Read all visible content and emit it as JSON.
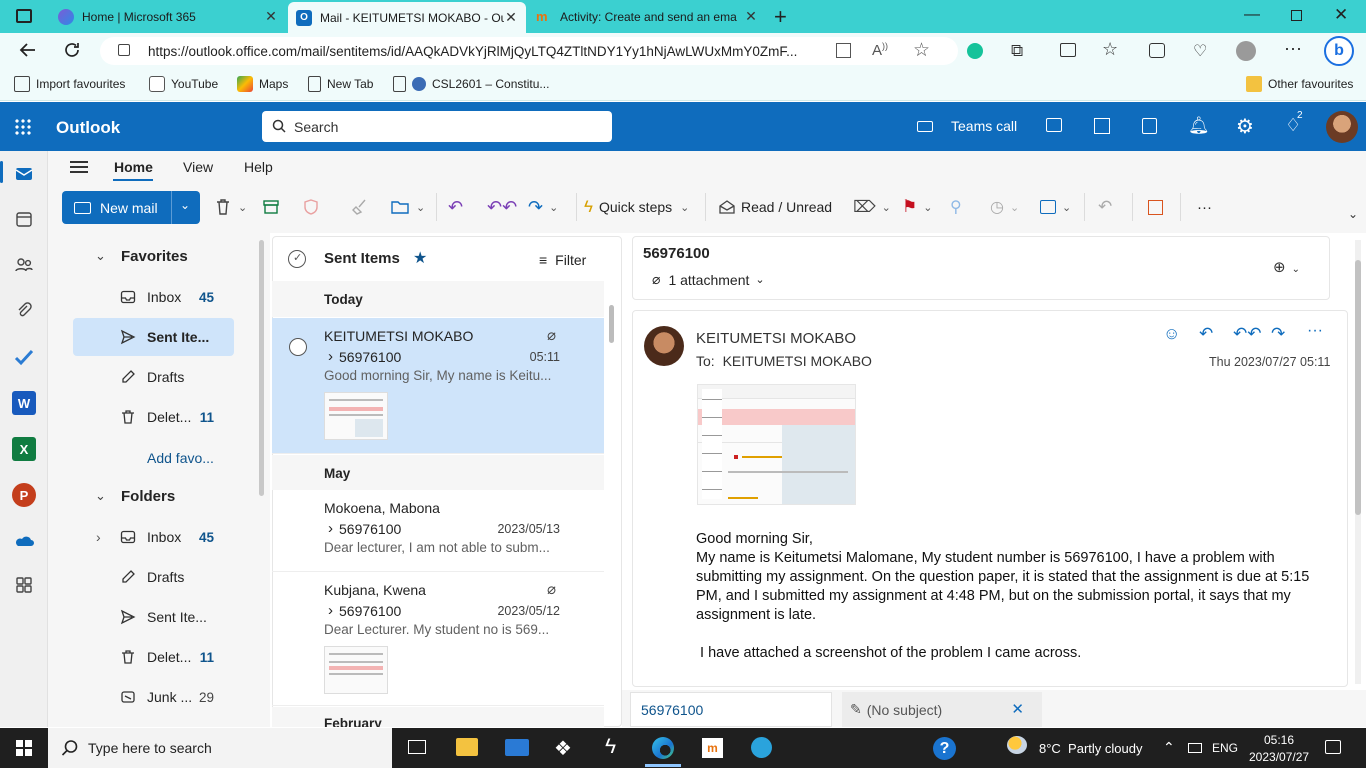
{
  "browser": {
    "tabs": [
      {
        "title": "Home | Microsoft 365",
        "active": false
      },
      {
        "title": "Mail - KEITUMETSI MOKABO - Out",
        "active": true
      },
      {
        "title": "Activity: Create and send an ema",
        "active": false
      }
    ],
    "url": "https://outlook.office.com/mail/sentitems/id/AAQkADVkYjRlMjQyLTQ4ZTltNDY1Yy1hNjAwLWUxMmY0ZmF...",
    "favorites": [
      "Import favourites",
      "YouTube",
      "Maps",
      "New Tab",
      "CSL2601 – Constitu...",
      "Other favourites"
    ]
  },
  "header": {
    "app_name": "Outlook",
    "search_placeholder": "Search",
    "teams_call": "Teams call",
    "notification_badge": "2"
  },
  "ribbon": {
    "tabs": [
      "Home",
      "View",
      "Help"
    ],
    "new_mail": "New mail",
    "quick_steps": "Quick steps",
    "read_unread": "Read / Unread",
    "more": "···"
  },
  "folders": {
    "favorites_heading": "Favorites",
    "favorites": [
      {
        "name": "Inbox",
        "count": "45"
      },
      {
        "name": "Sent Ite...",
        "count": ""
      },
      {
        "name": "Drafts",
        "count": ""
      },
      {
        "name": "Delet...",
        "count": "11"
      }
    ],
    "add_favorite": "Add favo...",
    "folders_heading": "Folders",
    "folders": [
      {
        "name": "Inbox",
        "count": "45"
      },
      {
        "name": "Drafts",
        "count": ""
      },
      {
        "name": "Sent Ite...",
        "count": ""
      },
      {
        "name": "Delet...",
        "count": "11"
      },
      {
        "name": "Junk ...",
        "count": "29"
      }
    ]
  },
  "message_list": {
    "title": "Sent Items",
    "filter": "Filter",
    "groups": [
      "Today",
      "May",
      "February"
    ],
    "messages": [
      {
        "sender": "KEITUMETSI MOKABO",
        "subject": "56976100",
        "date": "05:11",
        "preview": "Good morning Sir, My name is Keitu..."
      },
      {
        "sender": "Mokoena, Mabona",
        "subject": "56976100",
        "date": "2023/05/13",
        "preview": "Dear lecturer, I am not able to subm..."
      },
      {
        "sender": "Kubjana, Kwena",
        "subject": "56976100",
        "date": "2023/05/12",
        "preview": "Dear Lecturer. My student no is 569..."
      }
    ]
  },
  "reading_pane": {
    "subject": "56976100",
    "attachments": "1 attachment",
    "from": "KEITUMETSI MOKABO",
    "to_label": "To:",
    "to": "KEITUMETSI MOKABO",
    "date": "Thu 2023/07/27 05:11",
    "body": {
      "greeting": "Good morning Sir,",
      "p1": "My name is Keitumetsi Malomane, My student number is 56976100, I have a problem with submitting my assignment. On the question paper, it is stated that the assignment is due at 5:15 PM, and  I submitted my assignment at 4:48 PM, but on the submission portal, it says that my assignment is late.",
      "p2": " I have attached a screenshot of the problem I came across."
    }
  },
  "compose_tabs": [
    {
      "label": "56976100"
    },
    {
      "label": "(No subject)"
    }
  ],
  "taskbar": {
    "search_placeholder": "Type here to search",
    "weather": "8°C  Partly cloudy",
    "language": "ENG",
    "time": "05:16",
    "date": "2023/07/27"
  },
  "colors": {
    "brand": "#0f6cbd",
    "tab_strip": "#3bd0d0",
    "selected": "#cfe4fa"
  }
}
